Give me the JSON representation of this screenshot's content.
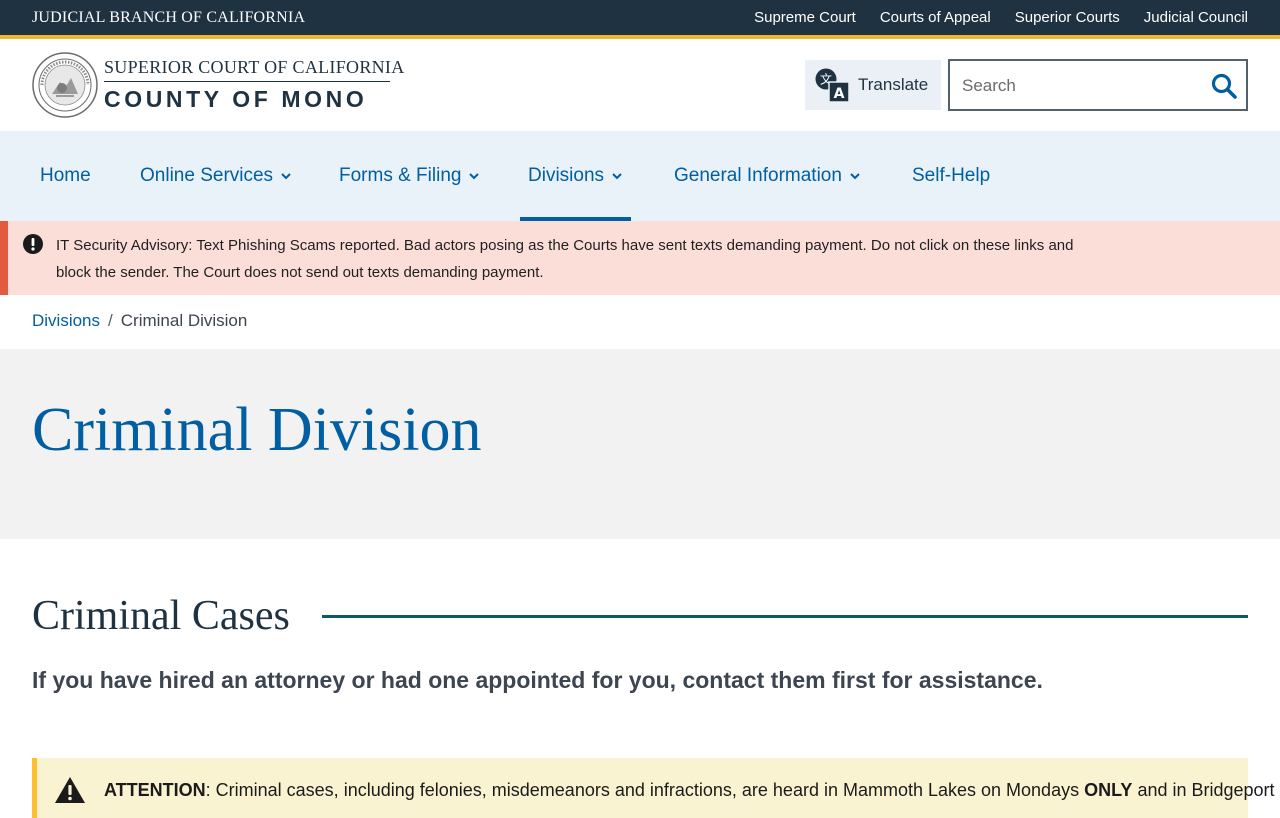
{
  "utility_bar": {
    "brand": "JUDICIAL BRANCH OF CALIFORNIA",
    "links": [
      "Supreme Court",
      "Courts of Appeal",
      "Superior Courts",
      "Judicial Council"
    ]
  },
  "header": {
    "seal_icon": "california-judicial-seal-icon",
    "logo_line1": "SUPERIOR COURT OF CALIFORNIA",
    "logo_line2": "COUNTY OF MONO",
    "translate_label": "Translate",
    "translate_icon": "translate-icon",
    "search_placeholder": "Search",
    "search_value": "",
    "search_icon": "search-icon"
  },
  "nav": {
    "items": [
      {
        "label": "Home",
        "dropdown": false
      },
      {
        "label": "Online Services",
        "dropdown": true
      },
      {
        "label": "Forms & Filing",
        "dropdown": true
      },
      {
        "label": "Divisions",
        "dropdown": true,
        "active": true
      },
      {
        "label": "General Information",
        "dropdown": true
      },
      {
        "label": "Self-Help",
        "dropdown": false
      }
    ]
  },
  "alert": {
    "icon": "exclamation-circle-icon",
    "line1": "IT Security Advisory: Text Phishing Scams reported. Bad actors posing as the Courts have sent texts demanding payment. Do not click on these links and",
    "line2": "block the sender. The Court does not send out texts demanding payment."
  },
  "breadcrumb": {
    "parent": "Divisions",
    "separator": "/",
    "current": "Criminal Division"
  },
  "page": {
    "title": "Criminal Division",
    "section_heading": "Criminal Cases",
    "lead": "If you have hired an attorney or had one appointed for you, contact them first for assistance."
  },
  "attention": {
    "icon": "warning-triangle-icon",
    "label": "ATTENTION",
    "text_before": ": Criminal cases, including felonies, misdemeanors and infractions, are heard in Mammoth Lakes on Mondays ",
    "emphasis": "ONLY",
    "text_after": " and in Bridgeport on"
  },
  "colors": {
    "utility_bg": "#1f3241",
    "gold_accent": "#f1b62f",
    "link_blue": "#005ea2",
    "nav_bg": "#eaf2f9",
    "alert_bg": "#fcded9",
    "alert_border": "#e25a40",
    "hero_bg": "#f2f2f2",
    "attention_bg": "#faf3d1",
    "attention_border": "#ffbe2e"
  }
}
